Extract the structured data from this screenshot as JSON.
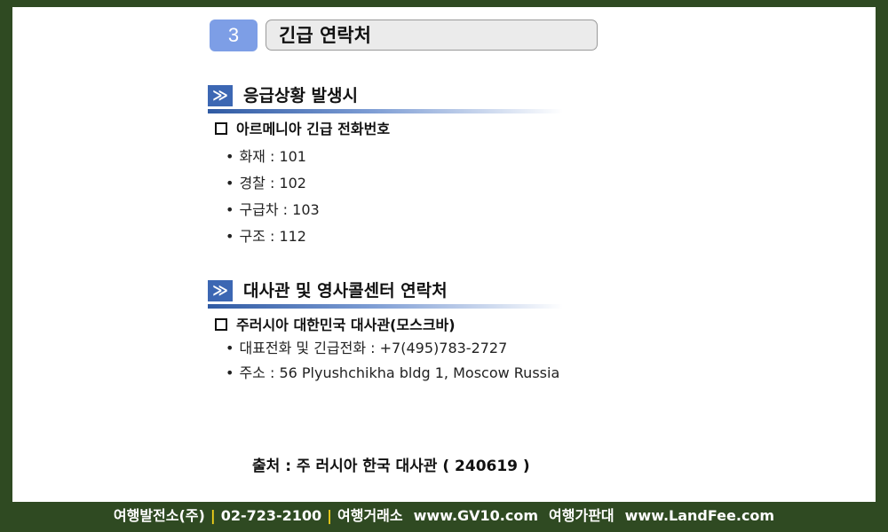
{
  "section_number": "3",
  "page_title": "긴급 연락처",
  "section_icon": "≫",
  "sections": [
    {
      "title": "응급상황 발생시",
      "subheading": "아르메니아 긴급 전화번호",
      "items": [
        "화재 : 101",
        "경찰 : 102",
        "구급차 : 103",
        "구조 : 112"
      ]
    },
    {
      "title": "대사관 및 영사콜센터 연락처",
      "subheading": "주러시아 대한민국 대사관(모스크바)",
      "items": [
        "대표전화 및 긴급전화 : +7(495)783-2727",
        "주소 : 56 Plyushchikha bldg 1, Moscow Russia"
      ]
    }
  ],
  "bullet_char": "•",
  "source": "출처 : 주 러시아 한국 대사관 ( 240619 )",
  "footer": {
    "company": "여행발전소(주)",
    "phone": "02-723-2100",
    "label1": "여행거래소",
    "url1": "www.GV10.com",
    "label2": "여행가판대",
    "url2": "www.LandFee.com",
    "separator": "|"
  },
  "colors": {
    "background_frame": "#2f4a22",
    "badge": "#7d9ee6",
    "section_icon": "#3c67b3",
    "separator": "#f4d21a"
  }
}
